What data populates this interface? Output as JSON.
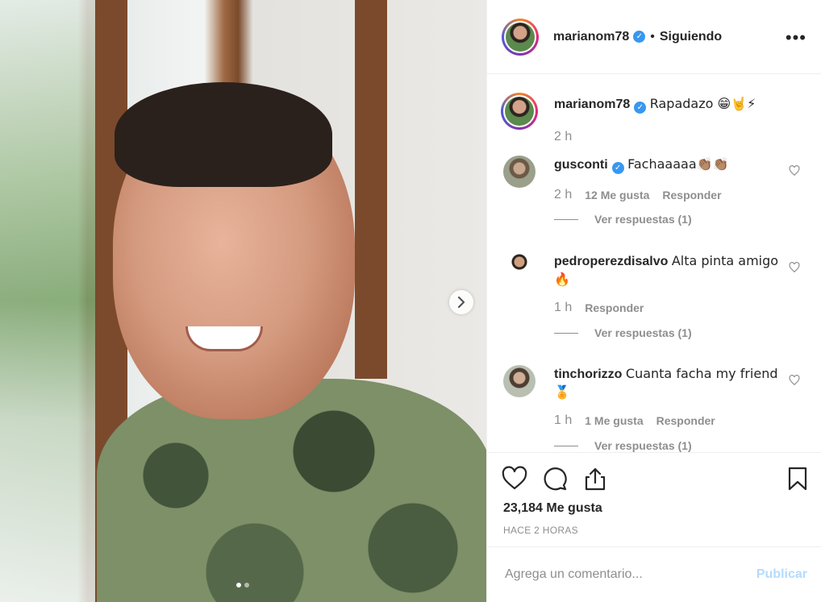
{
  "post": {
    "author": "marianom78",
    "follow_status": "Siguiendo",
    "separator": "•",
    "more_icon": "more-horizontal-icon",
    "slides_total": 2,
    "slide_active": 1
  },
  "caption": {
    "user": "marianom78",
    "text": "Rapadazo 😁🤘⚡",
    "time": "2 h"
  },
  "comments": [
    {
      "user": "gusconti",
      "verified": true,
      "text": "Fachaaaaa👏🏽👏🏽",
      "time": "2 h",
      "likes": "12 Me gusta",
      "reply": "Responder",
      "view_replies": "Ver respuestas (1)"
    },
    {
      "user": "pedroperezdisalvo",
      "verified": false,
      "text": "Alta pinta amigo 🔥",
      "time": "1 h",
      "likes": "",
      "reply": "Responder",
      "view_replies": "Ver respuestas (1)"
    },
    {
      "user": "tinchorizzo",
      "verified": false,
      "text": "Cuanta facha my friend 🏅",
      "time": "1 h",
      "likes": "1 Me gusta",
      "reply": "Responder",
      "view_replies": "Ver respuestas (1)"
    }
  ],
  "actions": {
    "like_icon": "heart-icon",
    "comment_icon": "comment-icon",
    "share_icon": "share-icon",
    "save_icon": "bookmark-icon"
  },
  "likes_count": "23,184 Me gusta",
  "posted_ago": "HACE 2 HORAS",
  "composer": {
    "placeholder": "Agrega un comentario...",
    "publish": "Publicar"
  },
  "colors": {
    "verified": "#3897f0",
    "publish_disabled": "#b3dbff",
    "muted": "#8e8e8e"
  }
}
